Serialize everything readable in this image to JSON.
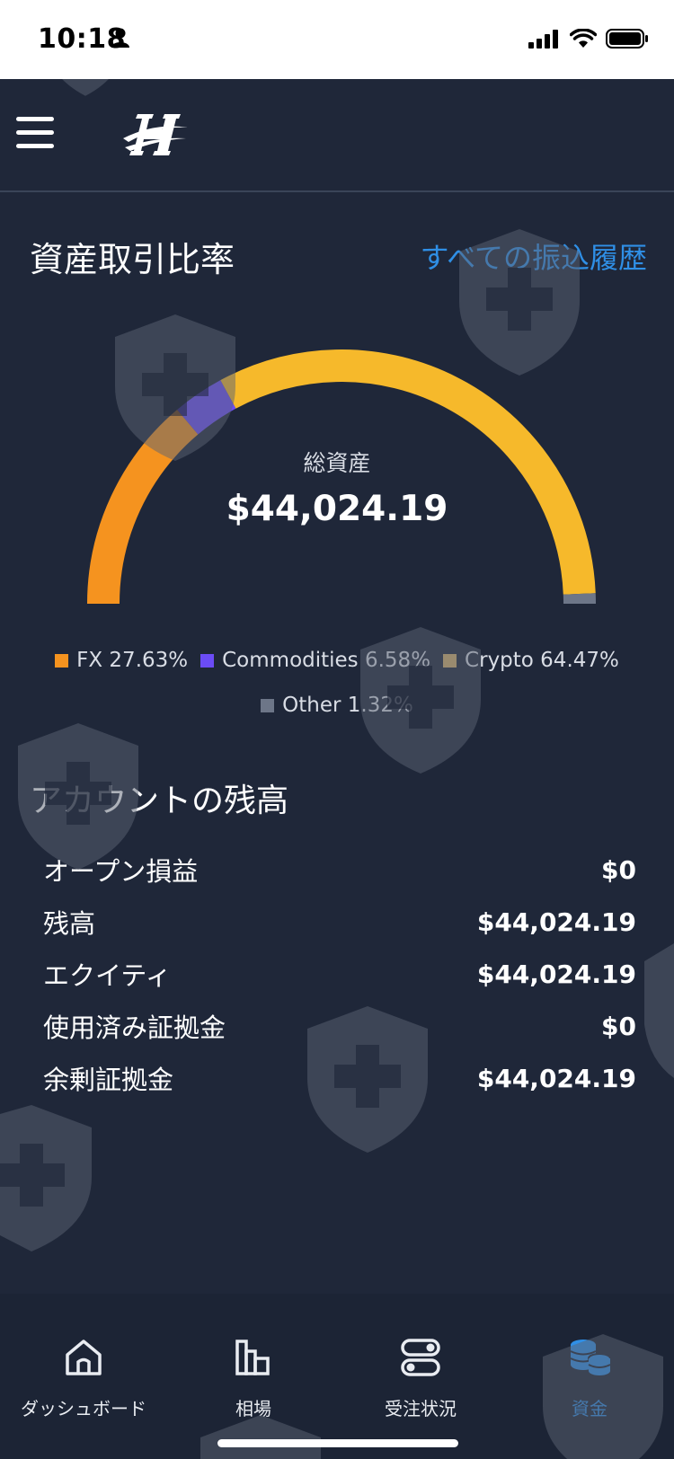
{
  "status": {
    "time": "10:18"
  },
  "header": {
    "menu_icon": "hamburger-menu-icon",
    "logo_icon": "brand-logo-icon"
  },
  "allocation": {
    "title": "資産取引比率",
    "link": "すべての振込履歴",
    "total_label": "総資産",
    "total_value": "$44,024.19"
  },
  "chart_data": {
    "type": "pie",
    "style": "semicircle-gauge",
    "title": "資産取引比率",
    "categories": [
      "FX",
      "Commodities",
      "Crypto",
      "Other"
    ],
    "values": [
      27.63,
      6.58,
      64.47,
      1.32
    ],
    "colors": [
      "#f5931f",
      "#6b4cf6",
      "#f6b92b",
      "#6d7688"
    ],
    "legend_colors": [
      "#f5931f",
      "#6b4cf6",
      "#d9b36a",
      "#6d7688"
    ],
    "labels": [
      "FX 27.63%",
      "Commodities 6.58%",
      "Crypto 64.47%",
      "Other 1.32%"
    ]
  },
  "balance": {
    "title": "アカウントの残高",
    "rows": [
      {
        "label": "オープン損益",
        "value": "$0"
      },
      {
        "label": "残高",
        "value": "$44,024.19"
      },
      {
        "label": "エクイティ",
        "value": "$44,024.19"
      },
      {
        "label": "使用済み証拠金",
        "value": "$0"
      },
      {
        "label": "余剰証拠金",
        "value": "$44,024.19"
      }
    ]
  },
  "tabs": [
    {
      "label": "ダッシュボード",
      "icon": "home-icon",
      "active": false
    },
    {
      "label": "相場",
      "icon": "bar-chart-icon",
      "active": false
    },
    {
      "label": "受注状況",
      "icon": "toggles-icon",
      "active": false
    },
    {
      "label": "資金",
      "icon": "coins-icon",
      "active": true
    }
  ],
  "colors": {
    "background": "#1f2739",
    "accent": "#2f8fe6",
    "watermark": "#5b6473"
  }
}
